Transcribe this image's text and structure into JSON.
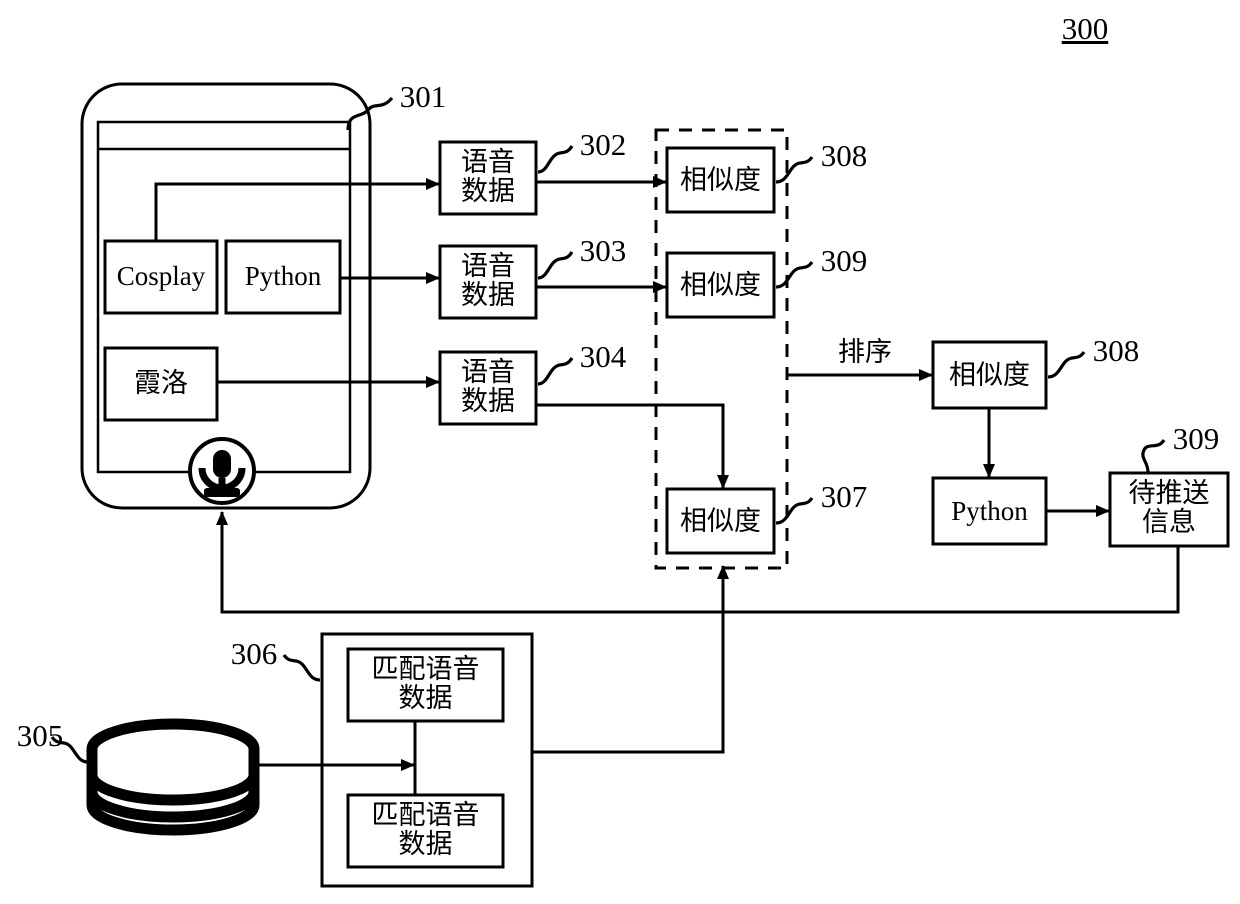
{
  "figure": {
    "number": "300",
    "type": "patent-flow-diagram"
  },
  "device": {
    "ref": "301",
    "screen_items": [
      {
        "label": "Cosplay"
      },
      {
        "label": "Python"
      },
      {
        "label": "霞洛"
      }
    ],
    "mic_icon": "microphone-icon"
  },
  "voice_data_boxes": [
    {
      "ref": "302",
      "label": "语音\n数据"
    },
    {
      "ref": "303",
      "label": "语音\n数据"
    },
    {
      "ref": "304",
      "label": "语音\n数据"
    }
  ],
  "similarity_group": {
    "boxes": [
      {
        "ref": "308",
        "label": "相似度"
      },
      {
        "ref": "309",
        "label": "相似度"
      },
      {
        "ref": "307",
        "label": "相似度"
      }
    ]
  },
  "sort_arrow_label": "排序",
  "result": {
    "similarity": {
      "ref": "308",
      "label": "相似度"
    },
    "python": {
      "label": "Python"
    },
    "push_info": {
      "ref": "309",
      "label": "待推送\n信息"
    }
  },
  "database": {
    "ref": "305",
    "icon": "database-cylinder-icon"
  },
  "match_container": {
    "ref": "306",
    "boxes": [
      {
        "label": "匹配语音\n数据"
      },
      {
        "label": "匹配语音\n数据"
      }
    ]
  }
}
